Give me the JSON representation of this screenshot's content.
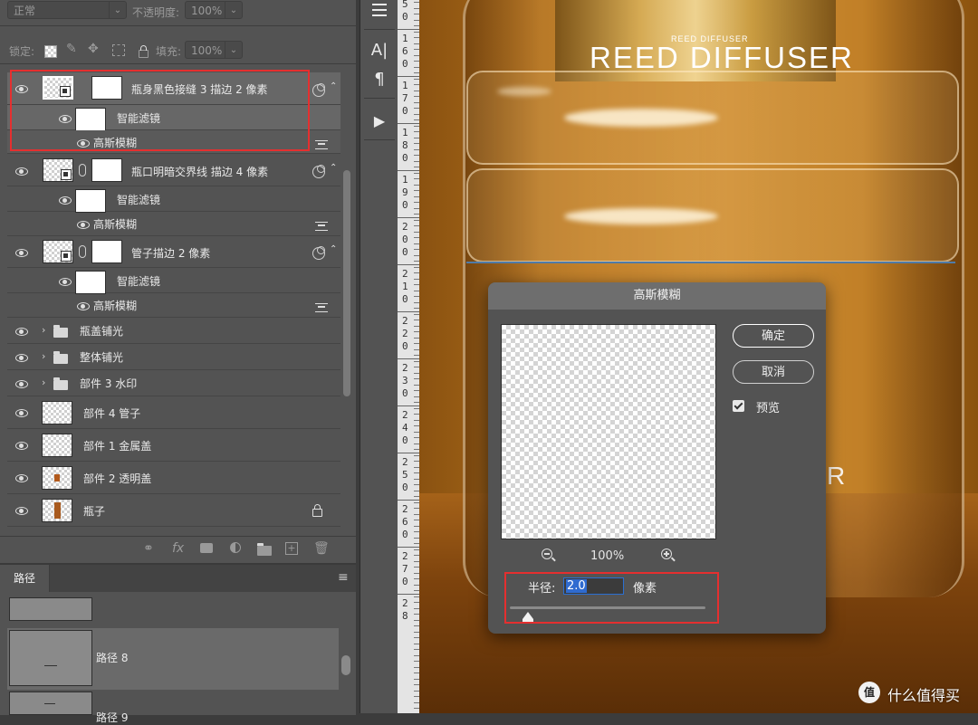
{
  "layers_panel": {
    "blend_mode": "正常",
    "opacity_label": "不透明度:",
    "opacity_value": "100%",
    "lock_label": "锁定:",
    "fill_label": "填充:",
    "fill_value": "100%",
    "layers": [
      {
        "name": "瓶身黑色接缝 3 描边 2 像素",
        "filter_label": "智能滤镜",
        "effect_label": "高斯模糊"
      },
      {
        "name": "瓶口明暗交界线 描边 4 像素",
        "filter_label": "智能滤镜",
        "effect_label": "高斯模糊"
      },
      {
        "name": "管子描边 2 像素",
        "filter_label": "智能滤镜",
        "effect_label": "高斯模糊"
      }
    ],
    "groups": [
      "瓶盖铺光",
      "整体铺光",
      "部件 3 水印"
    ],
    "plain_layers": [
      "部件 4 管子",
      "部件 1 金属盖",
      "部件 2 透明盖",
      "瓶子"
    ],
    "bottom_tools": [
      "link-icon",
      "fx-icon",
      "mask-icon",
      "adjustment-icon",
      "folder-icon",
      "new-layer-icon",
      "trash-icon"
    ],
    "fx_glyph": "fx"
  },
  "paths_panel": {
    "tab_label": "路径",
    "menu_glyph": "≡",
    "items": [
      {
        "name": ""
      },
      {
        "name": "路径 8"
      },
      {
        "name": "路径 9"
      }
    ]
  },
  "tools": {
    "icons": [
      "sliders-icon",
      "type-options-icon",
      "paragraph-icon",
      "play-icon"
    ],
    "type_glyph": "A|",
    "paragraph_glyph": "¶",
    "play_glyph": "▶"
  },
  "ruler": {
    "labels": [
      "150",
      "160",
      "170",
      "180",
      "190",
      "200",
      "210",
      "220",
      "230",
      "240",
      "250",
      "260",
      "270",
      "28"
    ]
  },
  "canvas": {
    "small_text": "REED DIFFUSER",
    "big_text": "REED DIFFUSER",
    "partial_text": "R"
  },
  "blur_dialog": {
    "title": "高斯模糊",
    "ok_label": "确定",
    "cancel_label": "取消",
    "preview_label": "预览",
    "preview_checked": true,
    "zoom_value": "100%",
    "radius_label": "半径:",
    "radius_value": "2.0",
    "unit_label": "像素"
  },
  "watermark": {
    "text": "什么值得买"
  },
  "colors": {
    "highlight_red": "#e52f2f",
    "panel_bg": "#535353",
    "selection_blue": "#2f6bd0"
  }
}
